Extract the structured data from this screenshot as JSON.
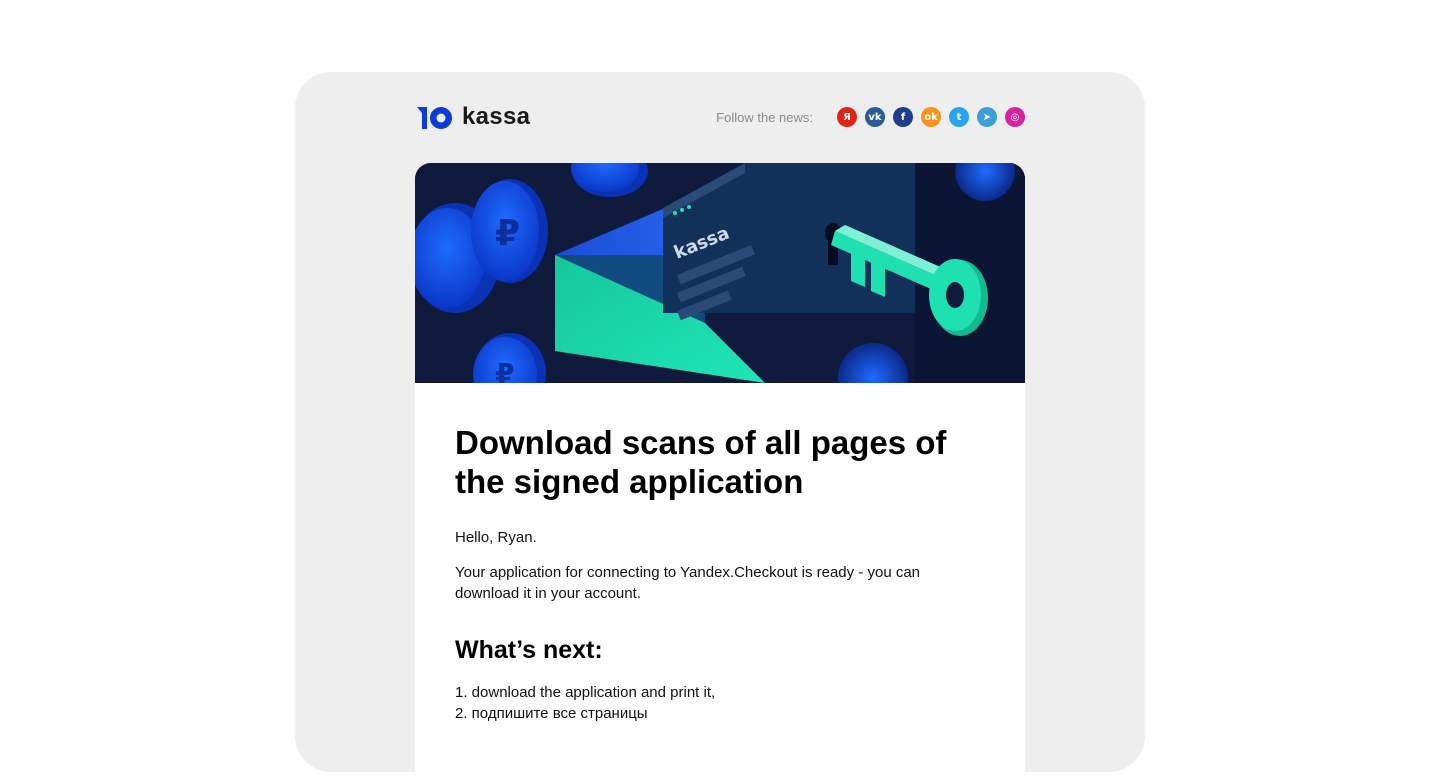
{
  "brand": {
    "logo_text": "kassa",
    "banner_logo_text": "kassa"
  },
  "header": {
    "social_label": "Follow the news:",
    "social_icons": [
      {
        "name": "yandex-icon",
        "glyph": "Я",
        "color": "#e2231a"
      },
      {
        "name": "vk-icon",
        "glyph": "vk",
        "color": "#2b5a9b"
      },
      {
        "name": "facebook-icon",
        "glyph": "f",
        "color": "#1e3e8c"
      },
      {
        "name": "odnoklassniki-icon",
        "glyph": "ok",
        "color": "#f7931e"
      },
      {
        "name": "twitter-icon",
        "glyph": "t",
        "color": "#2aa3ef"
      },
      {
        "name": "telegram-icon",
        "glyph": "➤",
        "color": "#3a9fd9"
      },
      {
        "name": "instagram-icon",
        "glyph": "◎",
        "color": "#d6249f"
      }
    ]
  },
  "email": {
    "title": "Download scans of all pages of the signed application",
    "greeting": "Hello, Ryan.",
    "body": "Your application for connecting to Yandex.Checkout is ready - you can download it in your account.",
    "subtitle": "What’s next:",
    "steps": [
      "1. download the application and print it,",
      "2. подпишите все страницы"
    ]
  },
  "colors": {
    "brand_blue": "#0b3bd9",
    "banner_dark": "#0f1a3d",
    "mint": "#1fe0b1",
    "frame_bg": "#efeeee"
  }
}
